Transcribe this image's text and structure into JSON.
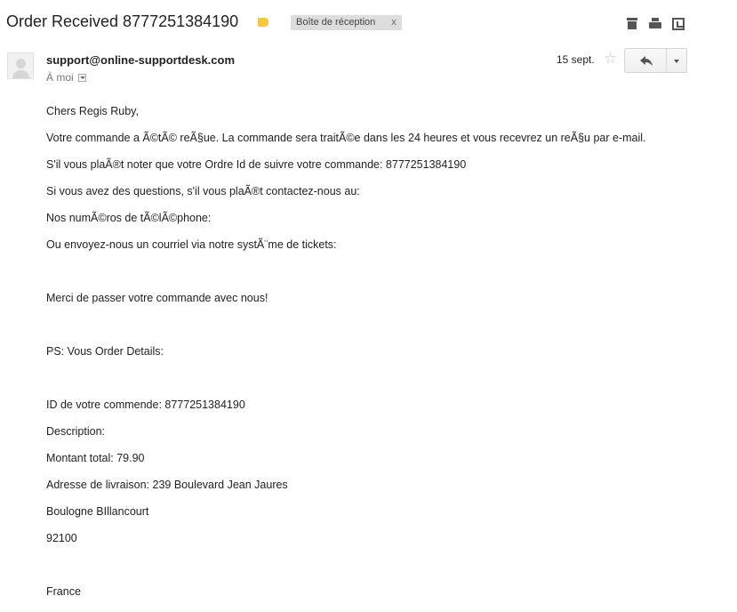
{
  "subject": "Order Received 8777251384190",
  "label": {
    "name": "Boîte de réception",
    "remove": "x"
  },
  "toolbar": {
    "icons": [
      "archive-icon",
      "print-icon",
      "new-window-icon"
    ]
  },
  "message": {
    "sender": "support@online-supportdesk.com",
    "recipient": "À moi",
    "date": "15 sept.",
    "star_icon": "star-icon",
    "reply_icon": "reply-icon",
    "more_icon": "chevron-down-icon"
  },
  "body": {
    "greeting": "Chers Regis Ruby,",
    "line1": "Votre commande a Ã©tÃ© reÃ§ue. La commande sera traitÃ©e dans les 24 heures et vous recevrez un reÃ§u par e-mail.",
    "line2": "S'il vous plaÃ®t noter que votre Ordre Id de suivre votre commande: 8777251384190",
    "line3": "Si vous avez des questions, s'il vous plaÃ®t contactez-nous au:",
    "line4": "Nos numÃ©ros de tÃ©lÃ©phone:",
    "line5": "Ou envoyez-nous un courriel via notre systÃ¨me de tickets:",
    "thanks": "Merci de passer votre commande avec nous!",
    "ps": "PS: Vous Order Details:",
    "order_id": "ID de votre commende: 8777251384190",
    "description": "Description:",
    "total": "Montant total: 79.90",
    "address": "Adresse de livraison: 239 Boulevard Jean Jaures",
    "city": "Boulogne BIllancourt",
    "zip": "92100",
    "country": "France"
  },
  "colors": {
    "label_tag": "#f6c93d",
    "label_bg": "#dddddd",
    "text": "#222222"
  }
}
